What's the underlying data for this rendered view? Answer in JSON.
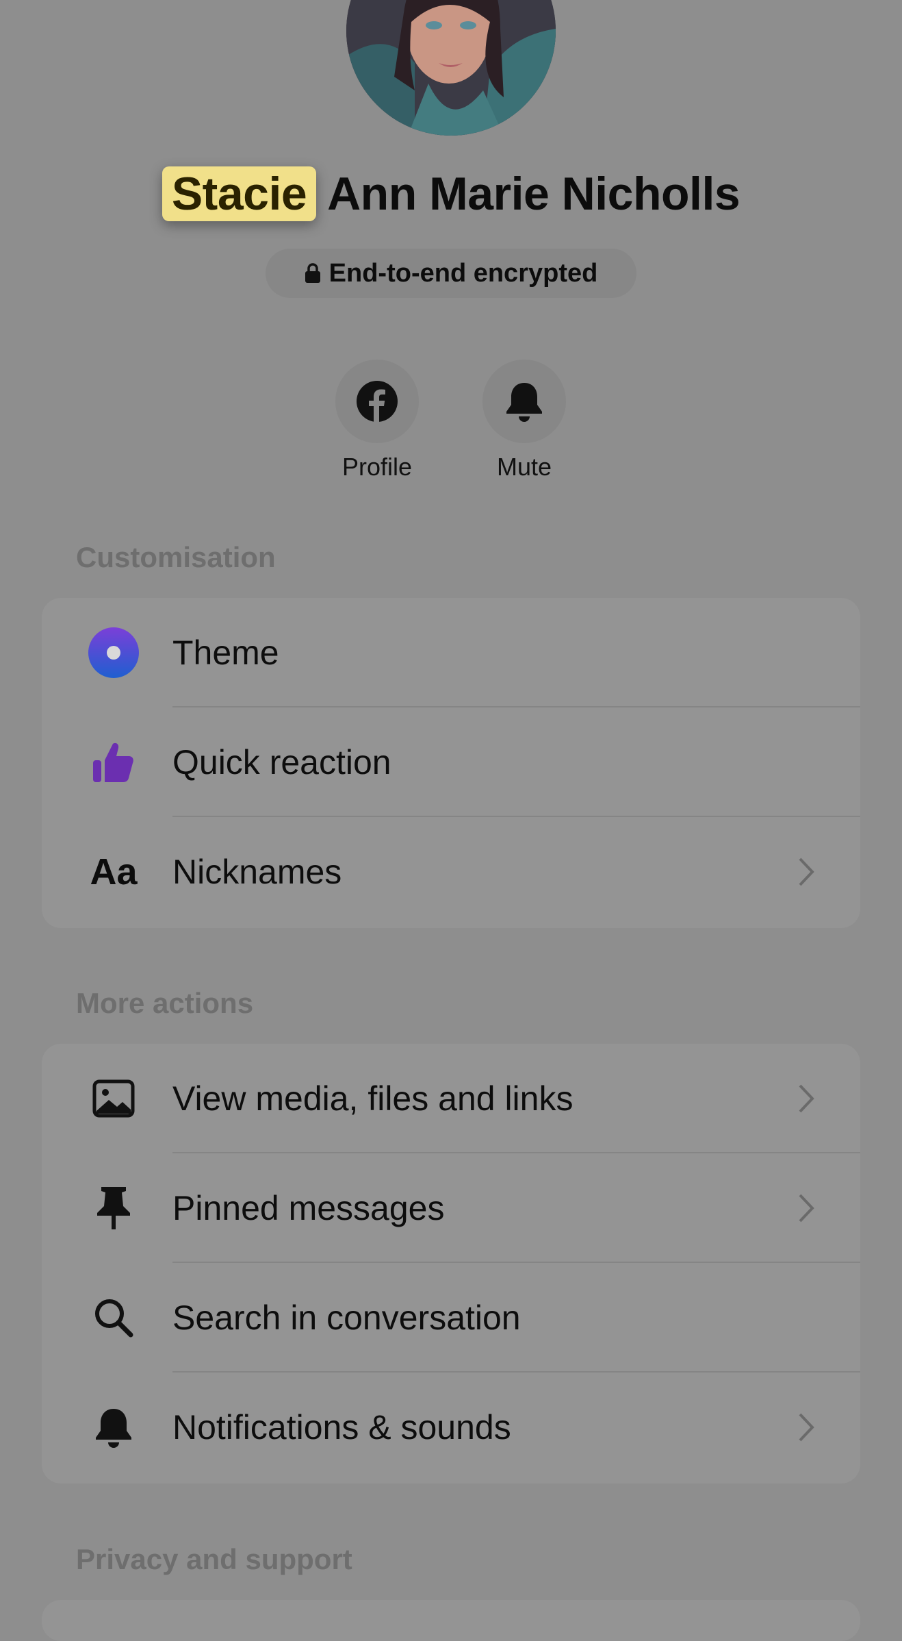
{
  "profile": {
    "name_highlight": "Stacie",
    "name_rest": "Ann Marie Nicholls",
    "encryption_label": "End-to-end encrypted"
  },
  "actions": [
    {
      "label": "Profile",
      "icon": "facebook-icon"
    },
    {
      "label": "Mute",
      "icon": "bell-icon"
    }
  ],
  "customisation": {
    "title": "Customisation",
    "items": [
      {
        "label": "Theme",
        "icon": "theme-icon",
        "chevron": false
      },
      {
        "label": "Quick reaction",
        "icon": "thumbs-up-icon",
        "chevron": false
      },
      {
        "label": "Nicknames",
        "icon": "aa-icon",
        "icon_text": "Aa",
        "chevron": true
      }
    ]
  },
  "more_actions": {
    "title": "More actions",
    "items": [
      {
        "label": "View media, files and links",
        "icon": "image-icon",
        "chevron": true
      },
      {
        "label": "Pinned messages",
        "icon": "pin-icon",
        "chevron": true
      },
      {
        "label": "Search in conversation",
        "icon": "search-icon",
        "chevron": false
      },
      {
        "label": "Notifications & sounds",
        "icon": "bell-icon",
        "chevron": true
      }
    ]
  },
  "privacy": {
    "title": "Privacy and support"
  },
  "colors": {
    "overlay_bg": "#8e8e8e",
    "highlight": "#f1e08a",
    "theme_gradient_start": "#7b3fd8",
    "theme_gradient_end": "#1f5fd0",
    "reaction_purple": "#6b2fb0"
  }
}
